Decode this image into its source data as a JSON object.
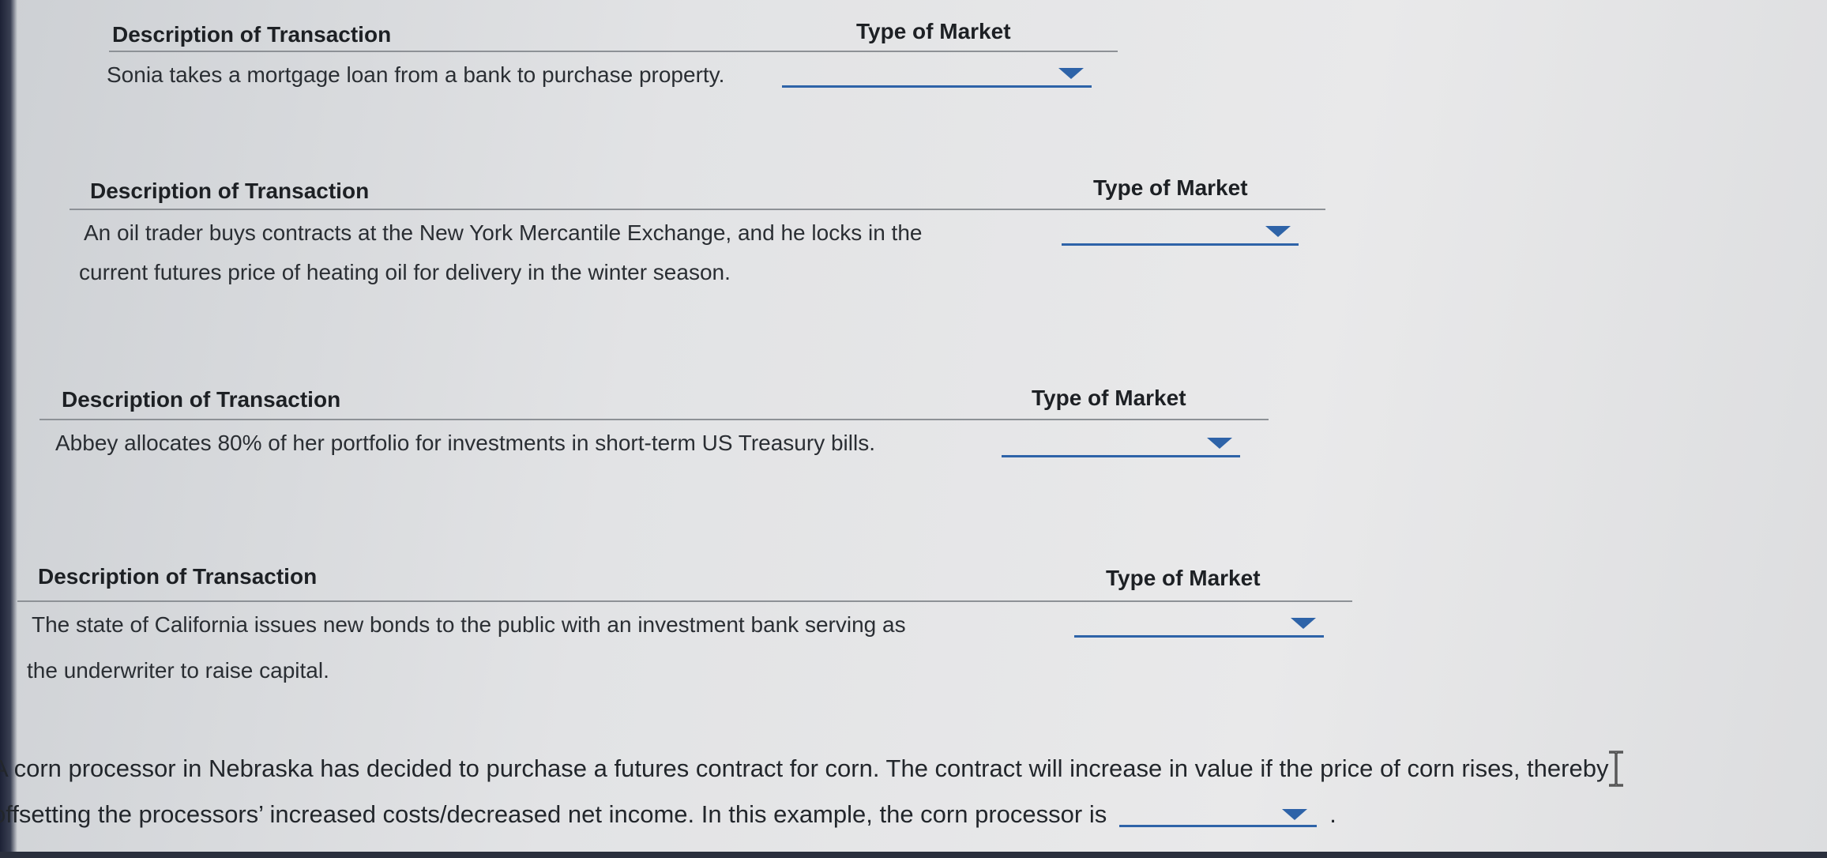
{
  "tables": [
    {
      "header_description": "Description of Transaction",
      "header_market": "Type of Market",
      "description_lines": [
        "Sonia takes a mortgage loan from a bank to purchase property."
      ],
      "selected_value": ""
    },
    {
      "header_description": "Description of Transaction",
      "header_market": "Type of Market",
      "description_lines": [
        "An oil trader buys contracts at the New York Mercantile Exchange, and he locks in the",
        "current futures price of heating oil for delivery in the winter season."
      ],
      "selected_value": ""
    },
    {
      "header_description": "Description of Transaction",
      "header_market": "Type of Market",
      "description_lines": [
        "Abbey allocates 80% of her portfolio for investments in short-term US Treasury bills."
      ],
      "selected_value": ""
    },
    {
      "header_description": "Description of Transaction",
      "header_market": "Type of Market",
      "description_lines": [
        "The state of California issues new bonds to the public with an investment bank serving as",
        "the underwriter to raise capital."
      ],
      "selected_value": ""
    }
  ],
  "question": {
    "line1": "A corn processor in Nebraska has decided to purchase a futures contract for corn. The contract will increase in value if the price of corn rises, thereby",
    "line2": "offsetting the processors’ increased costs/decreased net income. In this example, the corn processor is",
    "trailing": ".",
    "selected_value": ""
  },
  "icons": {
    "dropdown": "caret-down-icon",
    "cursor": "text-cursor-icon"
  },
  "colors": {
    "accent": "#2e63a8",
    "rule": "#8d9196",
    "text": "#1f2328"
  }
}
